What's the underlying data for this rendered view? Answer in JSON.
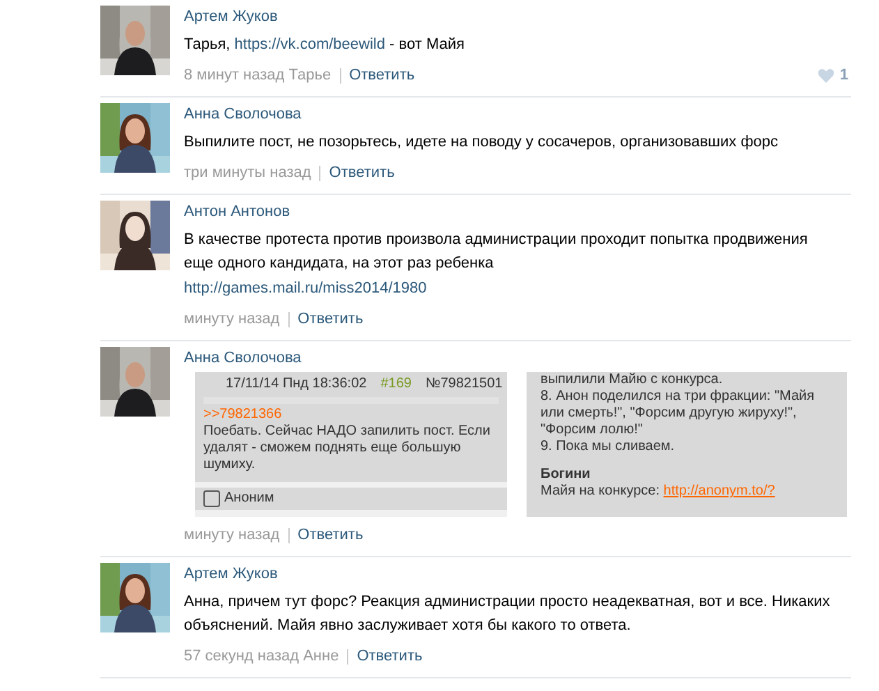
{
  "comments": [
    {
      "author": "Артем Жуков",
      "text": [
        {
          "text": "Тарья, "
        },
        {
          "text": "https://vk.com/beewild",
          "kind": "link"
        },
        {
          "text": " - вот Майя"
        }
      ],
      "time": "8 минут назад Тарье",
      "reply": "Ответить",
      "likes": "1"
    },
    {
      "author": "Анна Сволочова",
      "text": [
        {
          "text": "Выпилите пост, не позорьтесь, идете на поводу у сосачеров, организовавших форс"
        }
      ],
      "time": "три минуты назад",
      "reply": "Ответить"
    },
    {
      "author": "Антон Антонов",
      "text": [
        {
          "text": "В качестве протеста против произвола администрации проходит попытка продвижения еще одного кандидата, на этот раз ребенка"
        }
      ],
      "link": "http://games.mail.ru/miss2014/1980",
      "time": "минуту назад",
      "reply": "Ответить"
    },
    {
      "author": "Анна Сволочова",
      "attachment": {
        "kind": "screenshot",
        "post": {
          "date": "17/11/14 Пнд 18:36:02",
          "number": "#169",
          "id": "№79821501",
          "quote": ">>79821366",
          "body": "Поебать. Сейчас НАДО запилить пост. Если удалят - сможем поднять еще большую шумиху."
        },
        "next_post": "Аноним",
        "right": [
          {
            "kind": "line",
            "text": "выпилили Майю с конкурса."
          },
          {
            "kind": "line",
            "text": "8. Анон поделился на три фракции: \"Майя или смерть!\", \"Форсим другую жируху!\", \"Форсим лолю!\""
          },
          {
            "kind": "line",
            "text": "9. Пока мы сливаем."
          },
          {
            "kind": "heading",
            "text": "Богини"
          },
          {
            "kind": "link",
            "text": "Майя на конкурсе: ",
            "link": "http://anonym.to/?"
          }
        ]
      },
      "time": "минуту назад",
      "reply": "Ответить"
    },
    {
      "author": "Артем Жуков",
      "text": [
        {
          "text": "Анна, причем тут форс? Реакция администрации просто неадекватная, вот и все. Никаких объяснений. Майя явно заслуживает хотя бы какого то ответа."
        }
      ],
      "time": "57 секунд назад Анне",
      "reply": "Ответить"
    }
  ]
}
